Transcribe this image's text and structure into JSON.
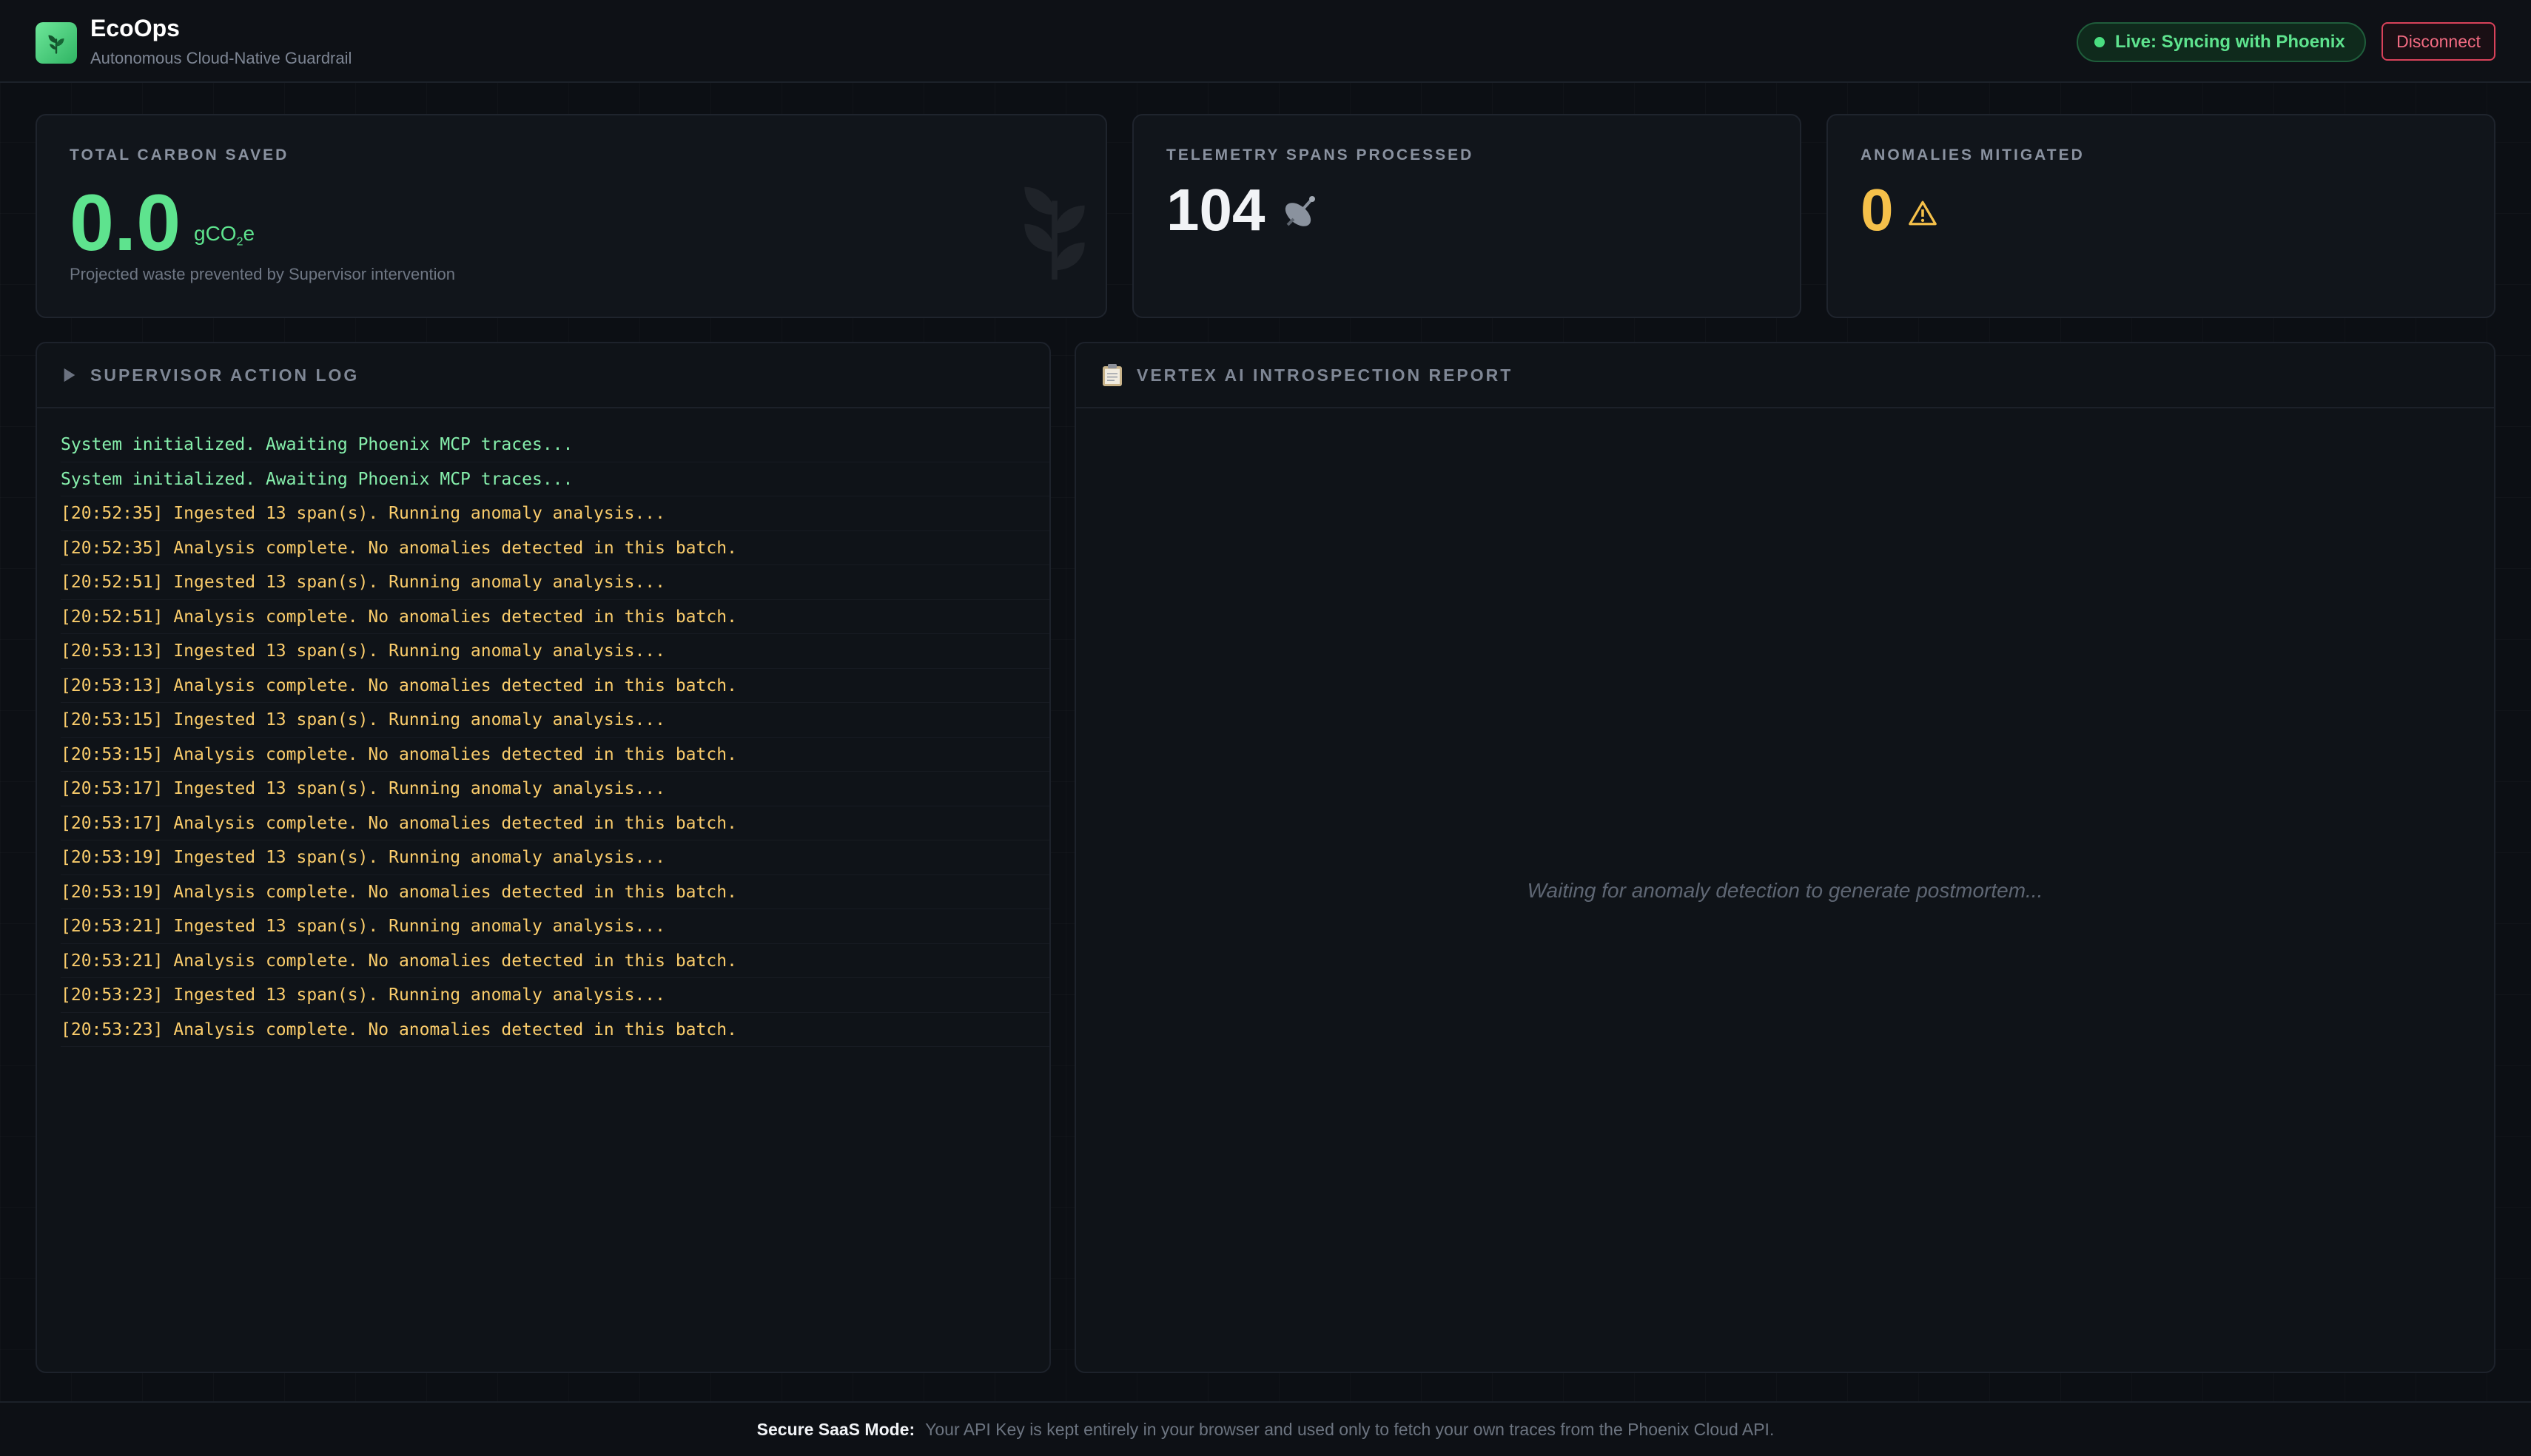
{
  "header": {
    "app_name": "EcoOps",
    "subtitle": "Autonomous Cloud-Native Guardrail",
    "logo_icon": "leaf-icon",
    "status_badge": "Live: Syncing with Phoenix",
    "disconnect_label": "Disconnect"
  },
  "stats": {
    "carbon": {
      "label": "TOTAL CARBON SAVED",
      "value": "0.0",
      "unit_prefix": "gCO",
      "unit_sub": "2",
      "unit_suffix": "e",
      "note": "Projected waste prevented by Supervisor intervention",
      "watermark_icon": "leaf-icon"
    },
    "spans": {
      "label": "TELEMETRY SPANS PROCESSED",
      "value": "104",
      "icon": "satellite-icon"
    },
    "anomalies": {
      "label": "ANOMALIES MITIGATED",
      "value": "0",
      "icon": "warning-icon"
    }
  },
  "log_panel": {
    "title": "SUPERVISOR ACTION LOG",
    "icon": "play-icon",
    "lines": [
      {
        "text": "System initialized. Awaiting Phoenix MCP traces...",
        "level": "ok"
      },
      {
        "text": "System initialized. Awaiting Phoenix MCP traces...",
        "level": "ok"
      },
      {
        "text": "[20:52:35] Ingested 13 span(s). Running anomaly analysis...",
        "level": "warn"
      },
      {
        "text": "[20:52:35] Analysis complete. No anomalies detected in this batch.",
        "level": "warn"
      },
      {
        "text": "[20:52:51] Ingested 13 span(s). Running anomaly analysis...",
        "level": "warn"
      },
      {
        "text": "[20:52:51] Analysis complete. No anomalies detected in this batch.",
        "level": "warn"
      },
      {
        "text": "[20:53:13] Ingested 13 span(s). Running anomaly analysis...",
        "level": "warn"
      },
      {
        "text": "[20:53:13] Analysis complete. No anomalies detected in this batch.",
        "level": "warn"
      },
      {
        "text": "[20:53:15] Ingested 13 span(s). Running anomaly analysis...",
        "level": "warn"
      },
      {
        "text": "[20:53:15] Analysis complete. No anomalies detected in this batch.",
        "level": "warn"
      },
      {
        "text": "[20:53:17] Ingested 13 span(s). Running anomaly analysis...",
        "level": "warn"
      },
      {
        "text": "[20:53:17] Analysis complete. No anomalies detected in this batch.",
        "level": "warn"
      },
      {
        "text": "[20:53:19] Ingested 13 span(s). Running anomaly analysis...",
        "level": "warn"
      },
      {
        "text": "[20:53:19] Analysis complete. No anomalies detected in this batch.",
        "level": "warn"
      },
      {
        "text": "[20:53:21] Ingested 13 span(s). Running anomaly analysis...",
        "level": "warn"
      },
      {
        "text": "[20:53:21] Analysis complete. No anomalies detected in this batch.",
        "level": "warn"
      },
      {
        "text": "[20:53:23] Ingested 13 span(s). Running anomaly analysis...",
        "level": "warn"
      },
      {
        "text": "[20:53:23] Analysis complete. No anomalies detected in this batch.",
        "level": "warn"
      }
    ]
  },
  "report_panel": {
    "title": "VERTEX AI INTROSPECTION REPORT",
    "icon": "clipboard-icon",
    "placeholder": "Waiting for anomaly detection to generate postmortem..."
  },
  "footer": {
    "strong": "Secure SaaS Mode:",
    "text": "Your API Key is kept entirely in your browser and used only to fetch your own traces from the Phoenix Cloud API."
  },
  "colors": {
    "accent_green": "#5ee38e",
    "warning_yellow": "#facc6b",
    "danger_red": "#f26b82",
    "background": "#0c0f14"
  }
}
